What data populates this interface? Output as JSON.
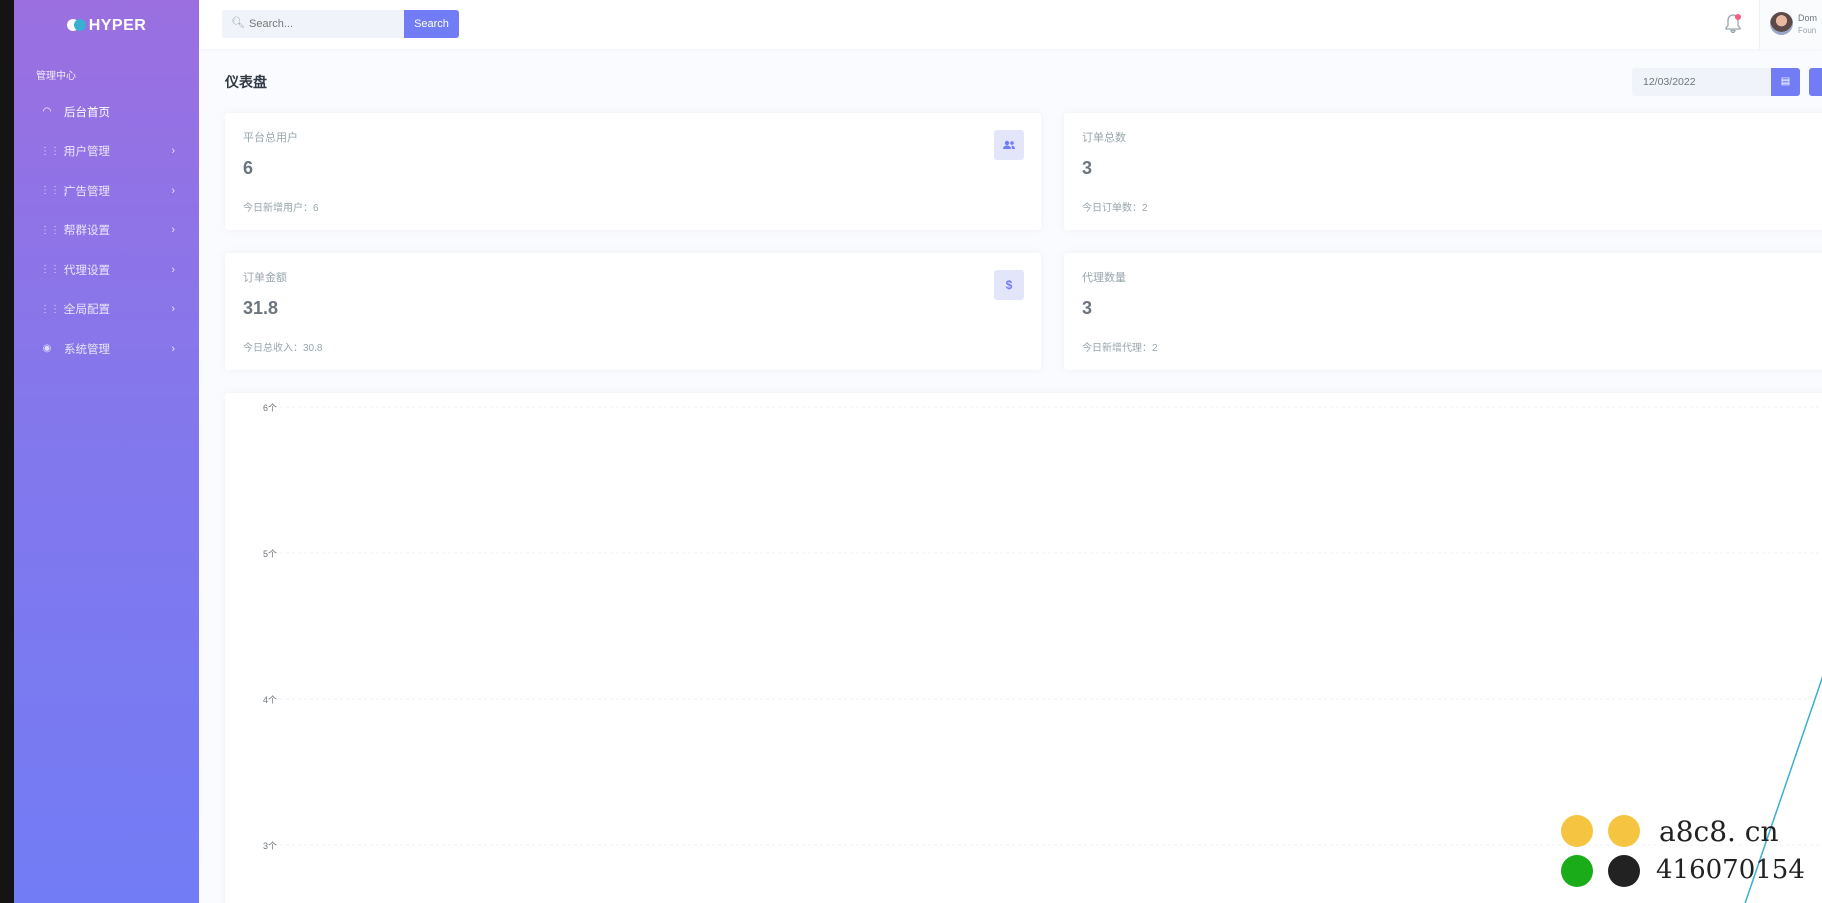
{
  "app": {
    "logo_text": "HYPER"
  },
  "sidebar": {
    "section_title": "管理中心",
    "items": [
      {
        "label": "后台首页",
        "icon": "dashboard-icon",
        "active": true,
        "has_children": false
      },
      {
        "label": "用户管理",
        "icon": "grid-icon",
        "active": false,
        "has_children": true
      },
      {
        "label": "广告管理",
        "icon": "grid-icon",
        "active": false,
        "has_children": true
      },
      {
        "label": "帮群设置",
        "icon": "grid-icon",
        "active": false,
        "has_children": true
      },
      {
        "label": "代理设置",
        "icon": "grid-icon",
        "active": false,
        "has_children": true
      },
      {
        "label": "全局配置",
        "icon": "grid-icon",
        "active": false,
        "has_children": true
      },
      {
        "label": "系统管理",
        "icon": "map-pin-icon",
        "active": false,
        "has_children": true
      }
    ]
  },
  "topbar": {
    "search_placeholder": "Search...",
    "search_button": "Search",
    "user_name": "Dom",
    "user_role": "Foun"
  },
  "page": {
    "title": "仪表盘",
    "date_value": "12/03/2022"
  },
  "stats": [
    {
      "label": "平台总用户",
      "value": "6",
      "sub": "今日新增用户：6",
      "icon": "users-icon"
    },
    {
      "label": "订单总数",
      "value": "3",
      "sub": "今日订单数：2",
      "icon": ""
    },
    {
      "label": "订单金额",
      "value": "31.8",
      "sub": "今日总收入：30.8",
      "icon": "dollar-icon"
    },
    {
      "label": "代理数量",
      "value": "3",
      "sub": "今日新增代理：2",
      "icon": ""
    }
  ],
  "chart_data": {
    "type": "line",
    "y_ticks": [
      "6个",
      "5个",
      "4个",
      "3个"
    ],
    "ylim": [
      3,
      6
    ],
    "grid": true,
    "series": [
      {
        "values": [
          2.6,
          4.6
        ],
        "color": "#39afd1"
      }
    ]
  },
  "watermark": {
    "site": "a8c8. cn",
    "qq": "416070154"
  },
  "colors": {
    "primary": "#727cf5",
    "info": "#39afd1",
    "danger": "#fa5c7c"
  }
}
